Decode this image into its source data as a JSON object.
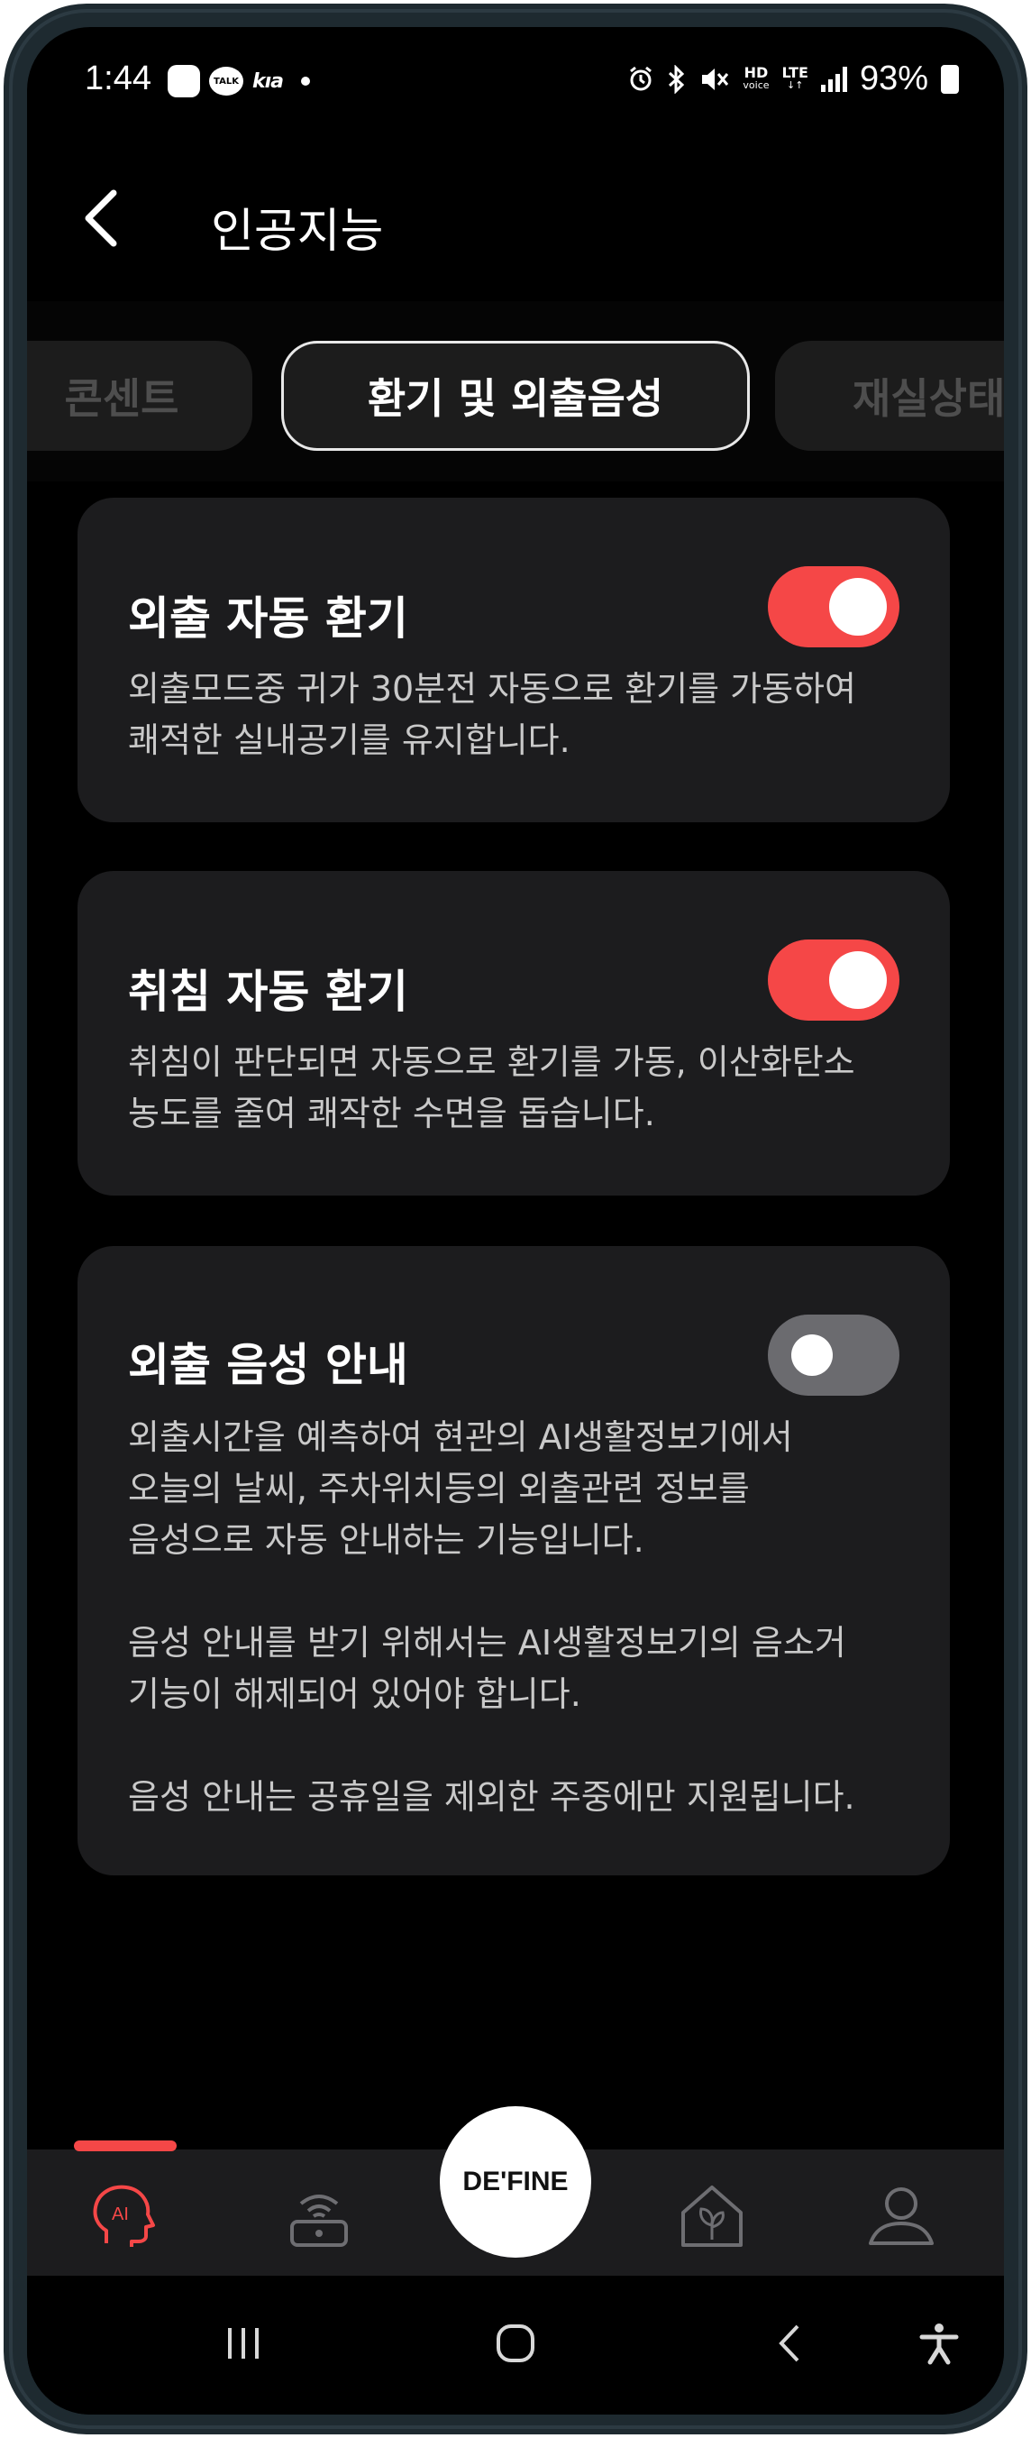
{
  "status_bar": {
    "time": "1:44",
    "talk_label": "TALK",
    "kia_label": "kıa",
    "network_hd": "HD",
    "network_voice": "voice",
    "network_lte": "LTE",
    "battery": "93%",
    "icons": [
      "square-app-icon",
      "kakaotalk-icon",
      "kia-icon",
      "alarm-icon",
      "bluetooth-icon",
      "mute-icon",
      "hd-voice-icon",
      "lte-icon",
      "signal-icon",
      "battery-icon"
    ]
  },
  "header": {
    "title": "인공지능",
    "back_icon": "chevron-left-icon"
  },
  "chips": [
    {
      "label": "콘센트",
      "active": false
    },
    {
      "label": "환기 및 외출음성",
      "active": true
    },
    {
      "label": "재실상태",
      "active": false
    }
  ],
  "cards": [
    {
      "title": "외출 자동 환기",
      "description": "외출모드중 귀가 30분전 자동으로 환기를 가동하여\n쾌적한 실내공기를 유지합니다.",
      "toggle_on": true
    },
    {
      "title": "취침 자동 환기",
      "description": "취침이 판단되면 자동으로 환기를 가동, 이산화탄소\n농도를 줄여 쾌작한 수면을 돕습니다.",
      "toggle_on": true
    },
    {
      "title": "외출 음성 안내",
      "description": "외출시간을 예측하여 현관의 AI생활정보기에서\n오늘의 날씨, 주차위치등의 외출관련 정보를\n음성으로 자동 안내하는 기능입니다.\n\n음성 안내를 받기 위해서는 AI생활정보기의 음소거\n기능이 해제되어 있어야 합니다.\n\n음성 안내는 공휴일을 제외한 주중에만 지원됩니다.",
      "toggle_on": false
    }
  ],
  "bottom_nav": {
    "center_label": "DE'FINE",
    "ai_label": "AI",
    "items": [
      "ai-head-icon",
      "router-icon",
      "define-home-button",
      "home-leaf-icon",
      "person-icon"
    ],
    "active_index": 0
  },
  "colors": {
    "accent": "#f54747",
    "background": "#000000",
    "card": "#1c1c1e",
    "toggle_off": "#6b6b6f"
  }
}
